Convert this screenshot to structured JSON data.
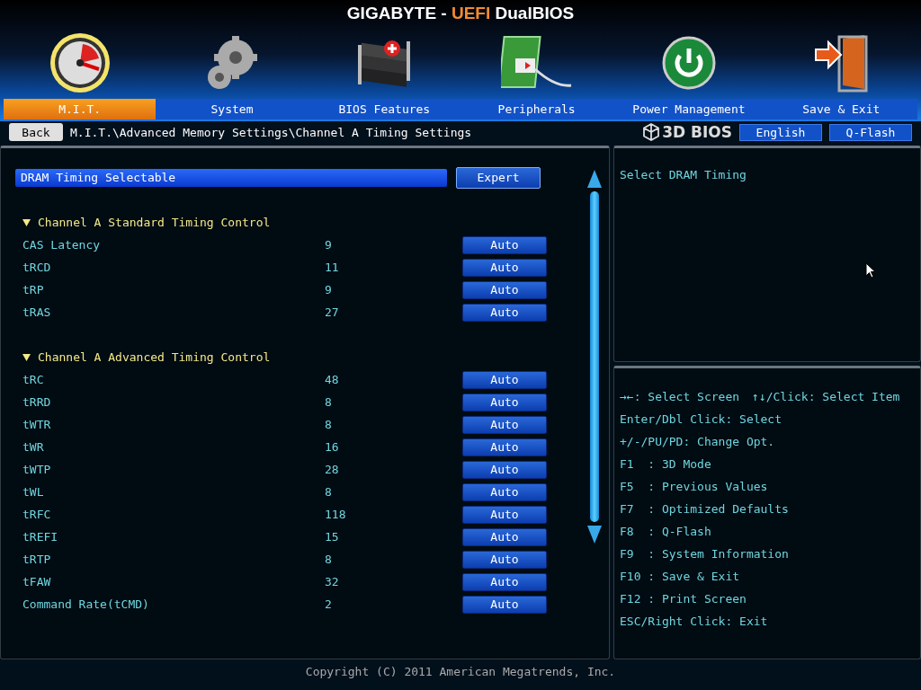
{
  "title": {
    "brand": "GIGABYTE",
    "separator": "-",
    "highlight": "UEFI",
    "product": "DualBIOS"
  },
  "tabs": [
    {
      "label": "M.I.T.",
      "kind": "gauge",
      "selected": true
    },
    {
      "label": "System",
      "kind": "gear",
      "selected": false
    },
    {
      "label": "BIOS Features",
      "kind": "chip",
      "selected": false
    },
    {
      "label": "Peripherals",
      "kind": "card",
      "selected": false
    },
    {
      "label": "Power Management",
      "kind": "power",
      "selected": false
    },
    {
      "label": "Save & Exit",
      "kind": "exit",
      "selected": false
    }
  ],
  "nav": {
    "back": "Back",
    "logo": "3D BIOS",
    "path": "M.I.T.\\Advanced Memory Settings\\Channel A Timing Settings",
    "language": "English",
    "qflash": "Q-Flash"
  },
  "top_setting": {
    "name": "DRAM Timing Selectable",
    "option": "Expert",
    "selected": true
  },
  "sections": [
    {
      "title": "Channel A Standard Timing Control",
      "items": [
        {
          "name": "CAS Latency",
          "value": "9",
          "option": "Auto"
        },
        {
          "name": "tRCD",
          "value": "11",
          "option": "Auto"
        },
        {
          "name": "tRP",
          "value": "9",
          "option": "Auto"
        },
        {
          "name": "tRAS",
          "value": "27",
          "option": "Auto"
        }
      ]
    },
    {
      "title": "Channel A Advanced Timing Control",
      "items": [
        {
          "name": "tRC",
          "value": "48",
          "option": "Auto"
        },
        {
          "name": "tRRD",
          "value": "8",
          "option": "Auto"
        },
        {
          "name": "tWTR",
          "value": "8",
          "option": "Auto"
        },
        {
          "name": "tWR",
          "value": "16",
          "option": "Auto"
        },
        {
          "name": "tWTP",
          "value": "28",
          "option": "Auto"
        },
        {
          "name": "tWL",
          "value": "8",
          "option": "Auto"
        },
        {
          "name": "tRFC",
          "value": "118",
          "option": "Auto"
        },
        {
          "name": "tREFI",
          "value": "15",
          "option": "Auto"
        },
        {
          "name": "tRTP",
          "value": "8",
          "option": "Auto"
        },
        {
          "name": "tFAW",
          "value": "32",
          "option": "Auto"
        },
        {
          "name": "Command Rate(tCMD)",
          "value": "2",
          "option": "Auto"
        }
      ]
    }
  ],
  "description": "Select DRAM Timing",
  "help_lines": [
    [
      "→←: Select Screen",
      "↑↓/Click: Select Item"
    ],
    [
      "Enter/Dbl Click: Select"
    ],
    [
      "+/-/PU/PD: Change Opt."
    ],
    [
      "F1  : 3D Mode"
    ],
    [
      "F5  : Previous Values"
    ],
    [
      "F7  : Optimized Defaults"
    ],
    [
      "F8  : Q-Flash"
    ],
    [
      "F9  : System Information"
    ],
    [
      "F10 : Save & Exit"
    ],
    [
      "F12 : Print Screen"
    ],
    [
      "ESC/Right Click: Exit"
    ]
  ],
  "copyright": "Copyright (C) 2011 American Megatrends, Inc."
}
